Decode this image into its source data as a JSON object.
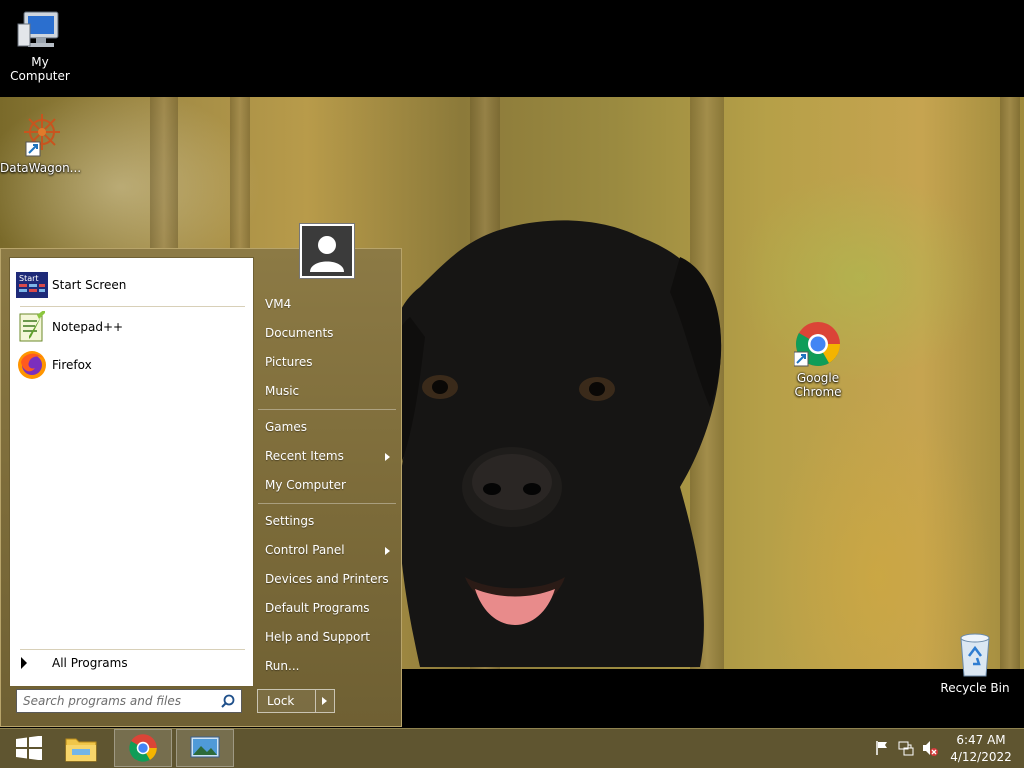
{
  "desktop": {
    "icons": {
      "my_computer": "My Computer",
      "datawagon": "DataWagon...",
      "chrome": "Google Chrome",
      "recycle_bin": "Recycle Bin"
    }
  },
  "start_menu": {
    "programs": [
      "Start Screen",
      "Notepad++",
      "Firefox"
    ],
    "start_screen_badge": "Start",
    "all_programs": "All Programs",
    "search_placeholder": "Search programs and files",
    "right": {
      "group1": [
        "VM4",
        "Documents",
        "Pictures",
        "Music"
      ],
      "group2": [
        "Games",
        "Recent Items",
        "My Computer"
      ],
      "group3": [
        "Settings",
        "Control Panel",
        "Devices and Printers",
        "Default Programs",
        "Help and Support",
        "Run..."
      ]
    },
    "lock_label": "Lock"
  },
  "taskbar": {
    "time": "6:47 AM",
    "date": "4/12/2022"
  },
  "colors": {
    "menu_bg": "#7d6c3a",
    "taskbar_bg": "#5f5530",
    "accent_blue": "#1e73be"
  },
  "icons": [
    "windows-logo-icon",
    "file-explorer-icon",
    "chrome-icon",
    "desktop-photo-icon",
    "flag-icon",
    "network-icon",
    "volume-muted-icon",
    "search-icon",
    "user-icon",
    "recycle-bin-icon",
    "computer-icon",
    "datawagon-icon",
    "notepadpp-icon",
    "firefox-icon",
    "start-screen-icon"
  ]
}
